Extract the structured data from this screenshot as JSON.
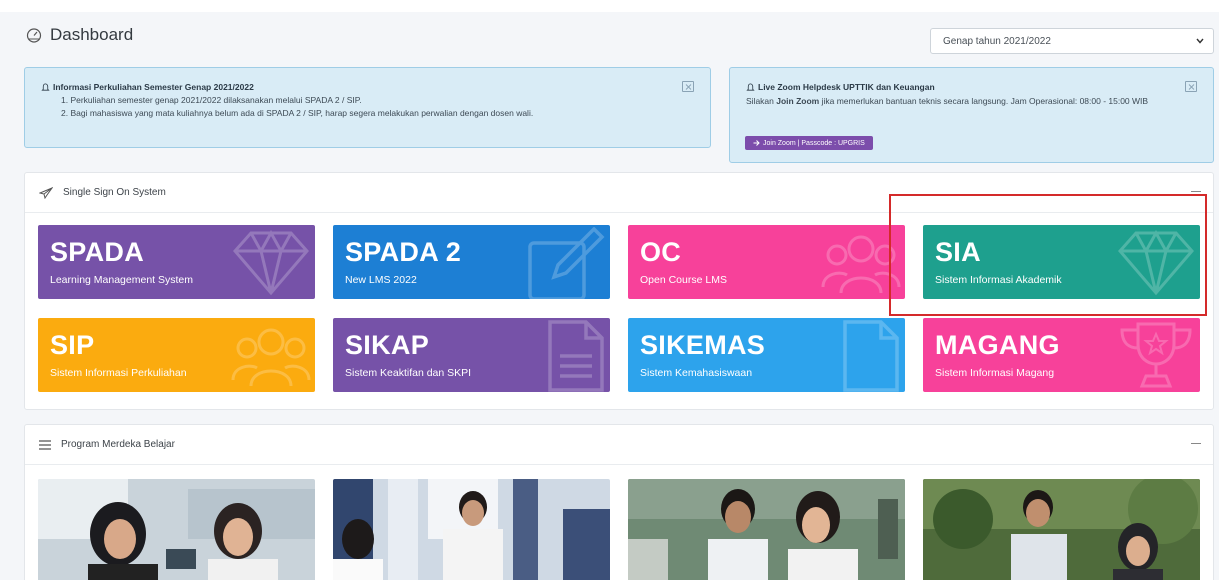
{
  "header": {
    "title": "Dashboard",
    "icon": "dashboard-icon",
    "semester_selected": "Genap tahun 2021/2022"
  },
  "alerts": {
    "info": {
      "title": "Informasi Perkuliahan Semester Genap 2021/2022",
      "lines": [
        "1. Perkuliahan semester genap 2021/2022 dilaksanakan melalui SPADA 2 / SIP.",
        "2. Bagi mahasiswa yang mata kuliahnya belum ada di SPADA 2 / SIP, harap segera melakukan perwalian dengan dosen wali."
      ]
    },
    "zoom": {
      "title": "Live Zoom Helpdesk UPTTIK dan Keuangan",
      "body_prefix": "Silakan ",
      "body_bold": "Join Zoom",
      "body_suffix": " jika memerlukan bantuan teknis secara langsung. Jam Operasional: 08:00 - 15:00 WIB",
      "button": "Join Zoom | Passcode : UPGRIS",
      "button_color": "#7c4dab"
    },
    "background": "#d9ecf6"
  },
  "sso": {
    "title": "Single Sign On System",
    "tiles": [
      {
        "name": "SPADA",
        "subtitle": "Learning Management System",
        "color": "#7652a8",
        "icon": "diamond-icon"
      },
      {
        "name": "SPADA 2",
        "subtitle": "New LMS 2022",
        "color": "#1d7fd4",
        "icon": "edit-icon"
      },
      {
        "name": "OC",
        "subtitle": "Open Course LMS",
        "color": "#f7419a",
        "icon": "users-icon"
      },
      {
        "name": "SIA",
        "subtitle": "Sistem Informasi Akademik",
        "color": "#1ea08e",
        "icon": "diamond-icon"
      },
      {
        "name": "SIP",
        "subtitle": "Sistem Informasi Perkuliahan",
        "color": "#fbab0f",
        "icon": "users-icon"
      },
      {
        "name": "SIKAP",
        "subtitle": "Sistem Keaktifan dan SKPI",
        "color": "#7652a8",
        "icon": "document-icon"
      },
      {
        "name": "SIKEMAS",
        "subtitle": "Sistem Kemahasiswaan",
        "color": "#2da3ec",
        "icon": "file-icon"
      },
      {
        "name": "MAGANG",
        "subtitle": "Sistem Informasi Magang",
        "color": "#f7419a",
        "icon": "trophy-icon"
      }
    ],
    "highlight_color": "#d42a2a"
  },
  "program": {
    "title": "Program Merdeka Belajar",
    "photos": [
      "photo-students-headsets",
      "photo-students-classroom",
      "photo-students-lab",
      "photo-students-outdoor"
    ]
  }
}
